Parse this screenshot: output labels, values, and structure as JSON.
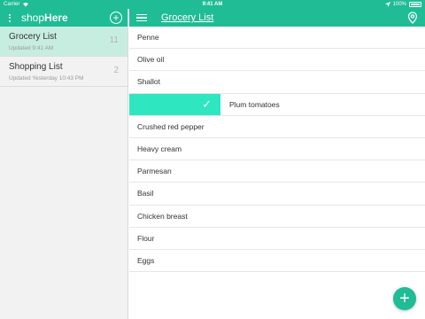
{
  "status_bar": {
    "carrier": "Carrier",
    "time": "9:41 AM",
    "battery": "100%"
  },
  "sidebar": {
    "brand_light": "shop",
    "brand_bold": "Here",
    "add_icon": "plus-circle-icon",
    "lists": [
      {
        "name": "Grocery List",
        "updated": "Updated 9:41 AM",
        "count": "11"
      },
      {
        "name": "Shopping List",
        "updated": "Updated Yesterday 10:43 PM",
        "count": "2"
      }
    ]
  },
  "main": {
    "title": "Grocery List",
    "items": [
      "Penne",
      "Olive oil",
      "Shallot",
      "Plum tomatoes",
      "Crushed red pepper",
      "Heavy cream",
      "Parmesan",
      "Basil",
      "Chicken breast",
      "Flour",
      "Eggs"
    ],
    "check_mark": "✓",
    "fab_label": "+"
  },
  "colors": {
    "brand": "#1fbc95",
    "swipe_action": "#2ee6bf",
    "active_list": "#c7ede1"
  }
}
